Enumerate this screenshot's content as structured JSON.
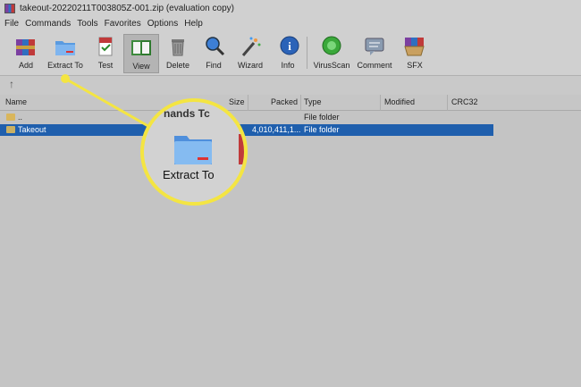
{
  "window": {
    "title": "takeout-20220211T003805Z-001.zip (evaluation copy)"
  },
  "menu": [
    "File",
    "Commands",
    "Tools",
    "Favorites",
    "Options",
    "Help"
  ],
  "toolbar": {
    "add": "Add",
    "extract_to": "Extract To",
    "test": "Test",
    "view": "View",
    "delete": "Delete",
    "find": "Find",
    "wizard": "Wizard",
    "info": "Info",
    "virusscan": "VirusScan",
    "comment": "Comment",
    "sfx": "SFX"
  },
  "columns": [
    "Name",
    "Size",
    "Packed",
    "Type",
    "Modified",
    "CRC32"
  ],
  "rows": [
    {
      "name": "..",
      "size": "",
      "packed": "",
      "type": "File folder",
      "modified": "",
      "crc": ""
    },
    {
      "name": "Takeout",
      "size": "",
      "packed": "4,010,411,1...",
      "type": "File folder",
      "modified": "",
      "crc": "",
      "selected": true
    }
  ],
  "magnifier": {
    "top_text": "nands   Tc",
    "label": "Extract To"
  },
  "colors": {
    "highlight": "#f4e542",
    "selection": "#1f5fad"
  }
}
